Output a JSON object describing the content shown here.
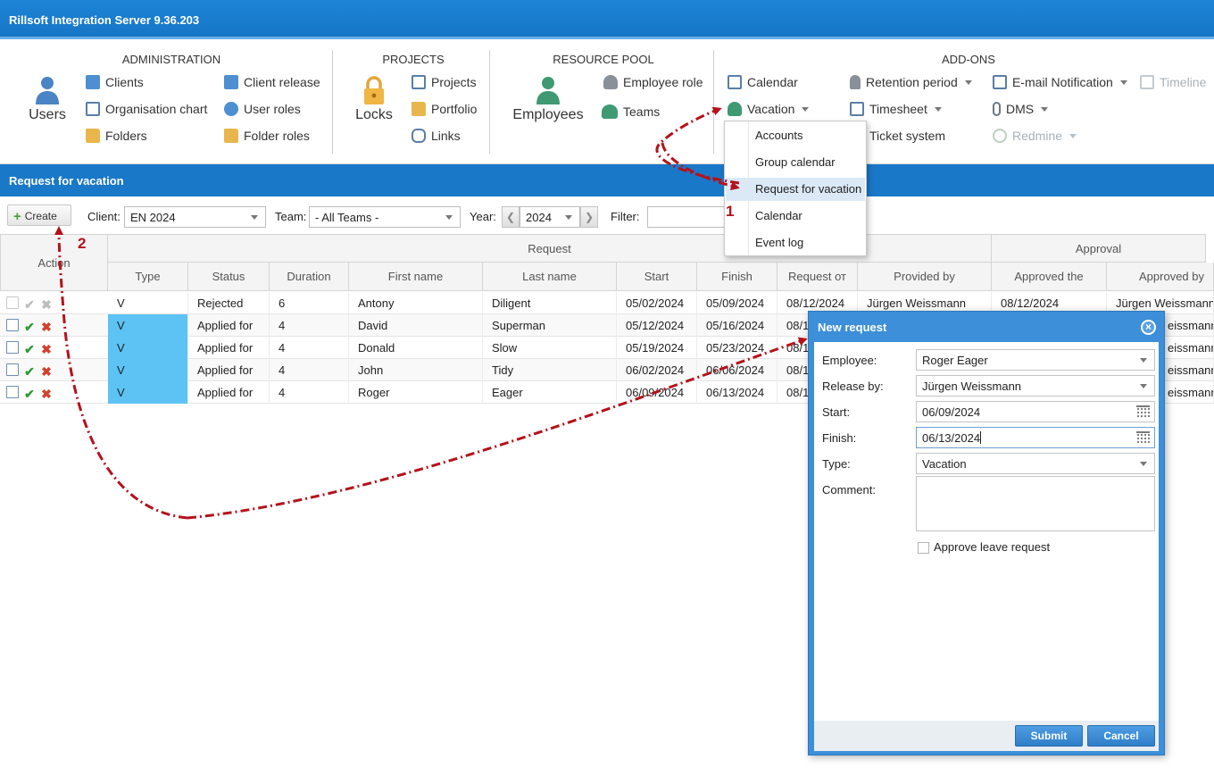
{
  "app": {
    "title": "Rillsoft Integration Server 9.36.203"
  },
  "ribbon": {
    "administration": {
      "title": "ADMINISTRATION",
      "users_label": "Users",
      "items": [
        "Clients",
        "Client release",
        "Organisation chart",
        "User roles",
        "Folders",
        "Folder roles"
      ]
    },
    "projects": {
      "title": "PROJECTS",
      "locks_label": "Locks",
      "items": [
        "Projects",
        "Portfolio",
        "Links"
      ]
    },
    "resource_pool": {
      "title": "RESOURCE POOL",
      "employees_label": "Employees",
      "items": [
        "Employee role",
        "Teams"
      ]
    },
    "addons": {
      "title": "ADD-ONS",
      "items": [
        "Calendar",
        "Retention period",
        "E-mail Notification",
        "Timeline",
        "Vacation",
        "Timesheet",
        "DMS",
        "Ticket system",
        "Redmine"
      ]
    }
  },
  "vacation_menu": {
    "items": [
      "Accounts",
      "Group calendar",
      "Request for vacation",
      "Calendar",
      "Event log"
    ],
    "selected": "Request for vacation"
  },
  "section": {
    "title": "Request for vacation"
  },
  "toolbar": {
    "create_label": "Create",
    "client_label": "Client:",
    "client_value": "EN 2024",
    "team_label": "Team:",
    "team_value": "- All Teams -",
    "year_label": "Year:",
    "year_prev": "❮",
    "year_value": "2024",
    "year_next": "❯",
    "filter_label": "Filter:",
    "filter_value": ""
  },
  "grid": {
    "action_header": "Action",
    "group_request": "Request",
    "group_approval": "Approval",
    "columns": [
      "Type",
      "Status",
      "Duration",
      "First name",
      "Last name",
      "Start",
      "Finish",
      "Request от",
      "Provided by",
      "Approved the",
      "Approved by"
    ],
    "rows": [
      {
        "type": "V",
        "status": "Rejected",
        "duration": "6",
        "first": "Antony",
        "last": "Diligent",
        "start": "05/02/2024",
        "finish": "05/09/2024",
        "request": "08/12/2024",
        "provided": "Jürgen Weissmann",
        "approved_the": "08/12/2024",
        "approved_by": "Jürgen Weissmann",
        "type_highlight": false,
        "actions_enabled": false
      },
      {
        "type": "V",
        "status": "Applied for",
        "duration": "4",
        "first": "David",
        "last": "Superman",
        "start": "05/12/2024",
        "finish": "05/16/2024",
        "request": "08/1",
        "provided": "",
        "approved_the": "",
        "approved_by": "eissmann",
        "type_highlight": true,
        "actions_enabled": true
      },
      {
        "type": "V",
        "status": "Applied for",
        "duration": "4",
        "first": "Donald",
        "last": "Slow",
        "start": "05/19/2024",
        "finish": "05/23/2024",
        "request": "08/1",
        "provided": "",
        "approved_the": "",
        "approved_by": "eissmann",
        "type_highlight": true,
        "actions_enabled": true
      },
      {
        "type": "V",
        "status": "Applied for",
        "duration": "4",
        "first": "John",
        "last": "Tidy",
        "start": "06/02/2024",
        "finish": "06/06/2024",
        "request": "08/1",
        "provided": "",
        "approved_the": "",
        "approved_by": "eissmann",
        "type_highlight": true,
        "actions_enabled": true
      },
      {
        "type": "V",
        "status": "Applied for",
        "duration": "4",
        "first": "Roger",
        "last": "Eager",
        "start": "06/09/2024",
        "finish": "06/13/2024",
        "request": "08/1",
        "provided": "",
        "approved_the": "",
        "approved_by": "eissmann",
        "type_highlight": true,
        "actions_enabled": true
      }
    ]
  },
  "dialog": {
    "title": "New request",
    "employee_label": "Employee:",
    "employee_value": "Roger Eager",
    "release_label": "Release by:",
    "release_value": "Jürgen Weissmann",
    "start_label": "Start:",
    "start_value": "06/09/2024",
    "finish_label": "Finish:",
    "finish_value": "06/13/2024",
    "type_label": "Type:",
    "type_value": "Vacation",
    "comment_label": "Comment:",
    "comment_value": "",
    "approve_label": "Approve leave request",
    "approve_checked": false,
    "submit_label": "Submit",
    "cancel_label": "Cancel"
  },
  "annotations": {
    "step1": "1",
    "step2": "2"
  },
  "colors": {
    "accent": "#1a78c8",
    "title_bar": "#1676c6",
    "type_highlight": "#5cc3f4",
    "annotation": "#b3121b",
    "ok": "#2f9a3a",
    "reject": "#d2412f"
  }
}
